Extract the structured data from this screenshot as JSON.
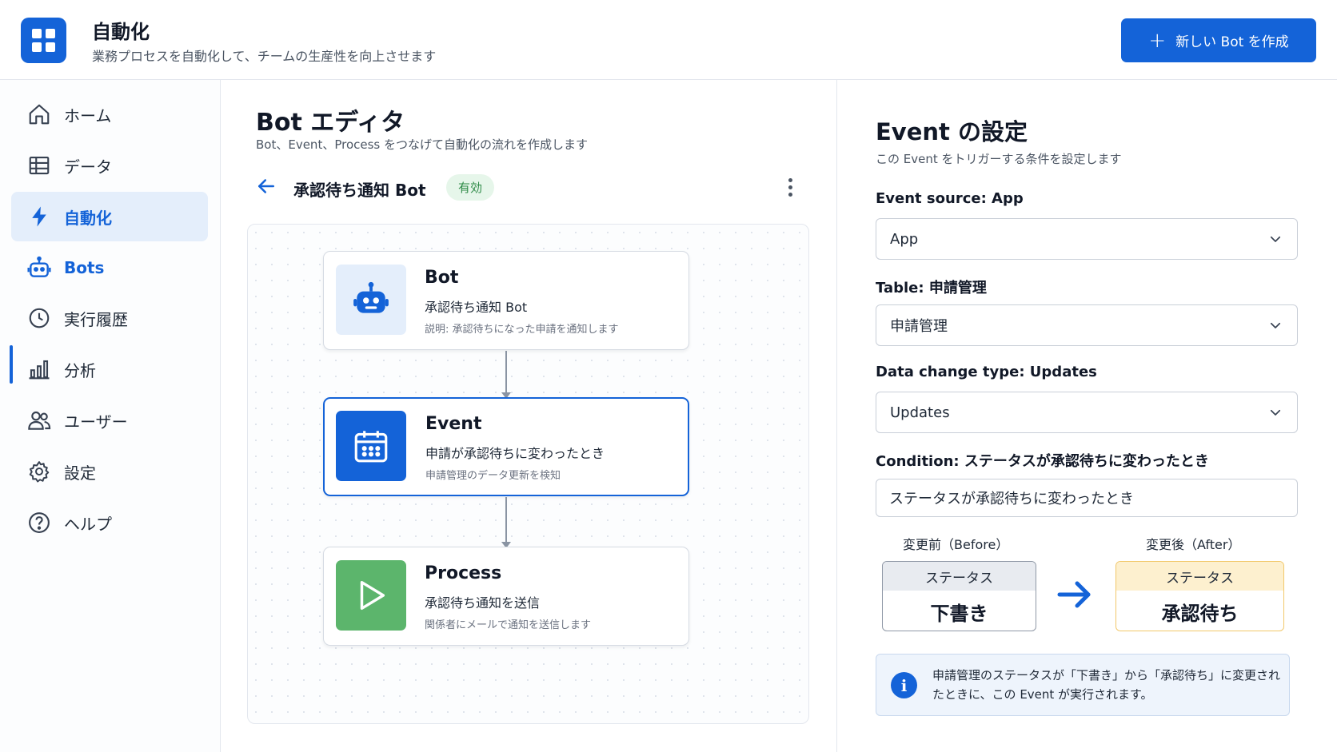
{
  "header": {
    "title": "自動化",
    "subtitle": "業務プロセスを自動化して、チームの生産性を向上させます",
    "create_button": "新しい Bot を作成"
  },
  "sidebar": {
    "items": [
      {
        "label": "ホーム",
        "icon": "home-icon"
      },
      {
        "label": "データ",
        "icon": "table-icon"
      },
      {
        "label": "自動化",
        "icon": "lightning-icon",
        "active": true
      },
      {
        "label": "Bots",
        "icon": "robot-icon",
        "sub_active": true
      },
      {
        "label": "実行履歴",
        "icon": "clock-icon"
      },
      {
        "label": "分析",
        "icon": "bar-chart-icon"
      },
      {
        "label": "ユーザー",
        "icon": "users-icon"
      },
      {
        "label": "設定",
        "icon": "gear-icon"
      },
      {
        "label": "ヘルプ",
        "icon": "help-icon"
      }
    ]
  },
  "editor": {
    "title": "Bot エディタ",
    "subtitle": "Bot、Event、Process をつなげて自動化の流れを作成します",
    "bot_name": "承認待ち通知 Bot",
    "status": "有効",
    "nodes": [
      {
        "title": "Bot",
        "line1": "承認待ち通知 Bot",
        "line2": "説明: 承認待ちになった申請を通知します",
        "icon": "robot-icon"
      },
      {
        "title": "Event",
        "line1": "申請が承認待ちに変わったとき",
        "line2": "申請管理のデータ更新を検知",
        "icon": "calendar-icon",
        "selected": true
      },
      {
        "title": "Process",
        "line1": "承認待ち通知を送信",
        "line2": "関係者にメールで通知を送信します",
        "icon": "play-icon"
      }
    ]
  },
  "panel": {
    "title": "Event の設定",
    "subtitle": "この Event をトリガーする条件を設定します",
    "source_label": "Event source: App",
    "source_value": "App",
    "table_label": "Table: 申請管理",
    "table_value": "申請管理",
    "change_label": "Data change type: Updates",
    "change_value": "Updates",
    "condition_label": "Condition: ステータスが承認待ちに変わったとき",
    "condition_value": "ステータスが承認待ちに変わったとき",
    "before_head": "変更前（Before）",
    "after_head": "変更後（After）",
    "before_field": "ステータス",
    "before_value": "下書き",
    "after_field": "ステータス",
    "after_value": "承認待ち",
    "info_text": "申請管理のステータスが「下書き」から「承認待ち」に変更されたときに、この Event が実行されます。"
  },
  "colors": {
    "accent": "#1463d8",
    "success": "#2e8b47",
    "process_green": "#5cb56c",
    "after_border": "#f2c86a"
  }
}
